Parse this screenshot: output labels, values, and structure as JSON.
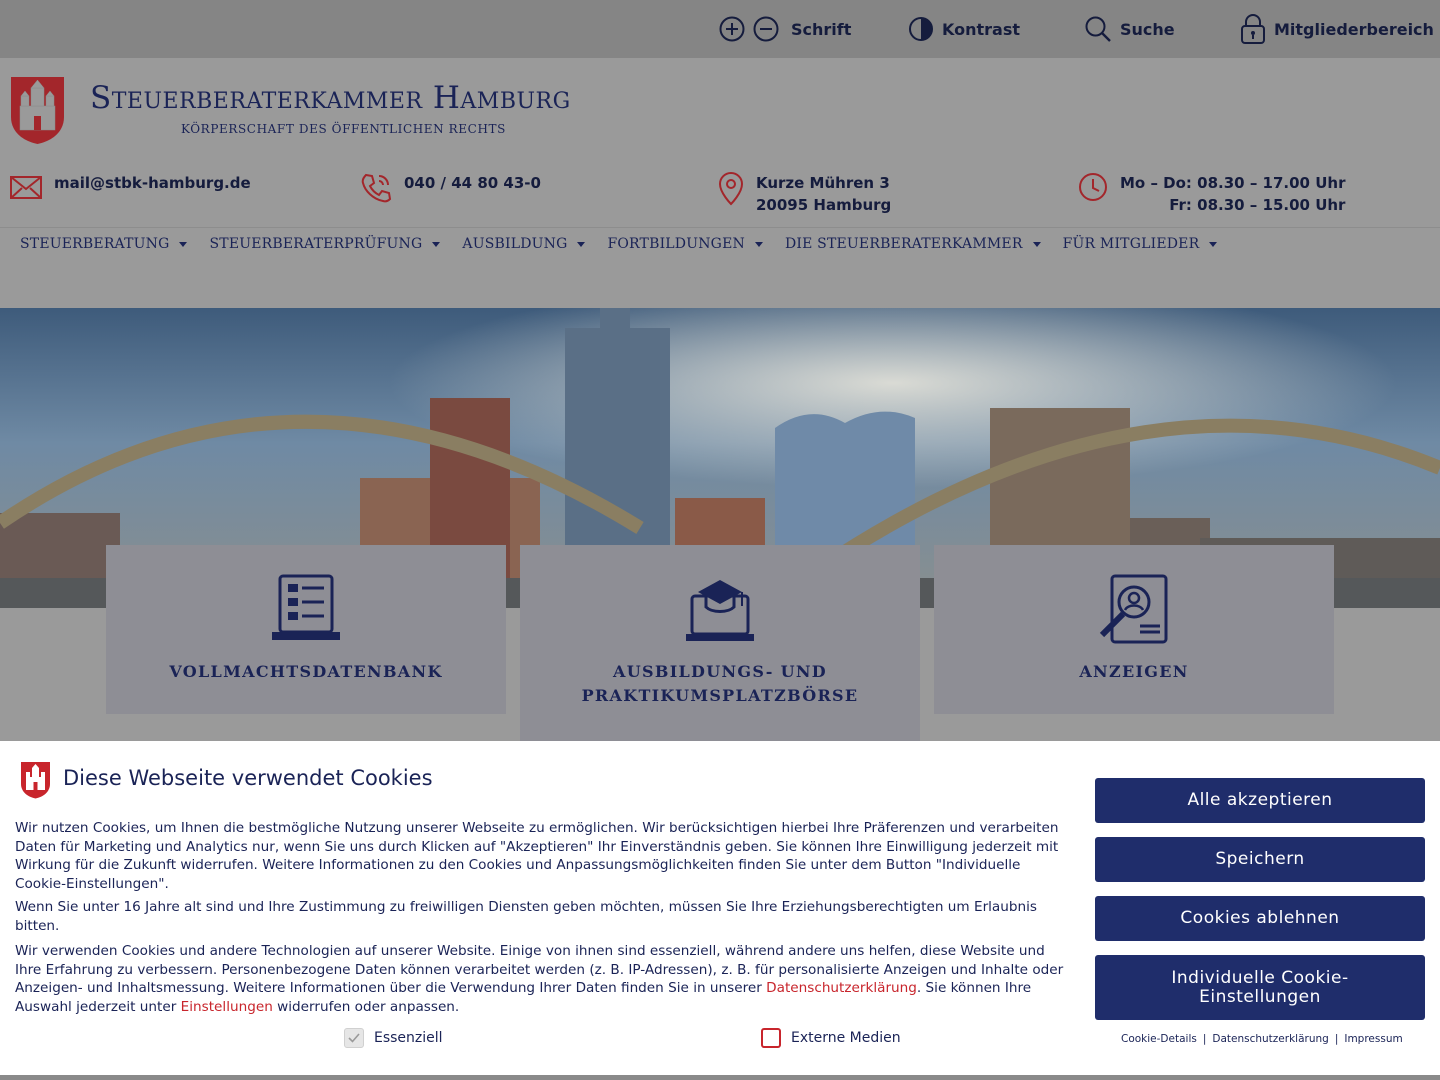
{
  "utility": {
    "font_label": "Schrift",
    "contrast_label": "Kontrast",
    "search_label": "Suche",
    "members_label": "Mitgliederbereich"
  },
  "brand": {
    "title": "Steuerberaterkammer Hamburg",
    "subtitle": "KÖRPERSCHAFT DES ÖFFENTLICHEN RECHTS"
  },
  "contact": {
    "email": "mail@stbk-hamburg.de",
    "phone": "040 / 44 80 43-0",
    "address_line1": "Kurze Mühren 3",
    "address_line2": "20095 Hamburg",
    "hours_line1": "Mo – Do: 08.30 – 17.00 Uhr",
    "hours_line2": "Fr: 08.30 – 15.00 Uhr"
  },
  "nav": {
    "items": [
      {
        "label": "STEUERBERATUNG"
      },
      {
        "label": "STEUERBERATERPRÜFUNG"
      },
      {
        "label": "AUSBILDUNG"
      },
      {
        "label": "FORTBILDUNGEN"
      },
      {
        "label": "DIE STEUERBERATERKAMMER"
      },
      {
        "label": "FÜR MITGLIEDER"
      }
    ]
  },
  "tiles": [
    {
      "label": "VOLLMACHTSDATENBANK",
      "icon": "document-list-icon"
    },
    {
      "label_line1": "AUSBILDUNGS- UND",
      "label_line2": "PRAKTIKUMSPLATZBÖRSE",
      "icon": "graduation-laptop-icon"
    },
    {
      "label": "ANZEIGEN",
      "icon": "profile-search-icon"
    }
  ],
  "cookie": {
    "title": "Diese Webseite verwendet Cookies",
    "p1": "Wir nutzen Cookies, um Ihnen die bestmögliche Nutzung unserer Webseite zu ermöglichen. Wir berücksichtigen hierbei Ihre Präferenzen und verarbeiten Daten für Marketing und Analytics nur, wenn Sie uns durch Klicken auf \"Akzeptieren\" Ihr Einverständnis geben. Sie können Ihre Einwilligung jederzeit mit Wirkung für die Zukunft widerrufen. Weitere Informationen zu den Cookies und Anpassungsmöglichkeiten finden Sie unter dem Button \"Individuelle Cookie-Einstellungen\".",
    "p2": "Wenn Sie unter 16 Jahre alt sind und Ihre Zustimmung zu freiwilligen Diensten geben möchten, müssen Sie Ihre Erziehungsberechtigten um Erlaubnis bitten.",
    "p3_a": "Wir verwenden Cookies und andere Technologien auf unserer Website. Einige von ihnen sind essenziell, während andere uns helfen, diese Website und Ihre Erfahrung zu verbessern. Personenbezogene Daten können verarbeitet werden (z. B. IP-Adressen), z. B. für personalisierte Anzeigen und Inhalte oder Anzeigen- und Inhaltsmessung. Weitere Informationen über die Verwendung Ihrer Daten finden Sie in unserer ",
    "p3_link1": "Datenschutzerklärung",
    "p3_b": ". Sie können Ihre Auswahl jederzeit unter ",
    "p3_link2": "Einstellungen",
    "p3_c": " widerrufen oder anpassen.",
    "check_essential": "Essenziell",
    "check_external": "Externe Medien",
    "btn_accept_all": "Alle akzeptieren",
    "btn_save": "Speichern",
    "btn_reject": "Cookies ablehnen",
    "btn_individual": "Individuelle Cookie-Einstellungen",
    "link_details": "Cookie-Details",
    "link_privacy": "Datenschutzerklärung",
    "link_imprint": "Impressum",
    "sep": "|"
  },
  "colors": {
    "brand_navy": "#1f2d6b",
    "accent_red": "#c8252c"
  }
}
